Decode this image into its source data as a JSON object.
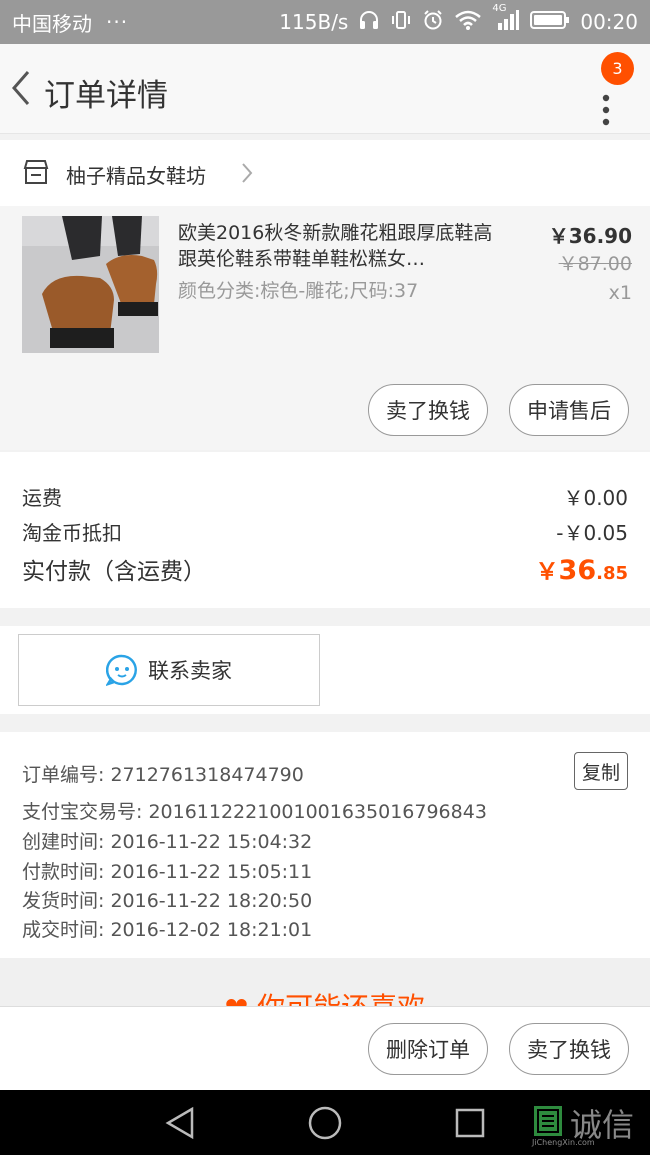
{
  "status_bar": {
    "carrier": "中国移动",
    "dots": "···",
    "speed": "115B/s",
    "network": "4G",
    "time": "00:20"
  },
  "header": {
    "title": "订单详情",
    "badge_count": "3"
  },
  "shop": {
    "name": "柚子精品女鞋坊"
  },
  "product": {
    "title": "欧美2016秋冬新款雕花粗跟厚底鞋高跟英伦鞋系带鞋单鞋松糕女…",
    "spec": "颜色分类:棕色-雕花;尺码:37",
    "price": "￥36.90",
    "original_price": "￥87.00",
    "quantity": "x1",
    "buttons": [
      "卖了换钱",
      "申请售后"
    ]
  },
  "fees": {
    "shipping_label": "运费",
    "shipping_value": "￥0.00",
    "coin_label": "淘金币抵扣",
    "coin_value": "-￥0.05",
    "total_label": "实付款（含运费）",
    "total_currency": "￥",
    "total_integer": "36",
    "total_decimal": ".85"
  },
  "contact": {
    "label": "联系卖家"
  },
  "order_info": {
    "lines": [
      "订单编号: 2712761318474790",
      "支付宝交易号: 2016112221001001635016796843",
      "创建时间: 2016-11-22 15:04:32",
      "付款时间: 2016-11-22 15:05:11",
      "发货时间: 2016-11-22 18:20:50",
      "成交时间: 2016-12-02 18:21:01"
    ],
    "copy_label": "复制"
  },
  "recommend": {
    "text": "你可能还喜欢"
  },
  "bottom_bar": {
    "delete_label": "删除订单",
    "resell_label": "卖了换钱"
  },
  "watermark": {
    "text": "诚信",
    "sub": "JiChengXin.com"
  },
  "colors": {
    "accent": "#ff5000",
    "status_bar": "#999999",
    "nav_bar": "#000000",
    "contact_icon": "#2aa3e6"
  }
}
